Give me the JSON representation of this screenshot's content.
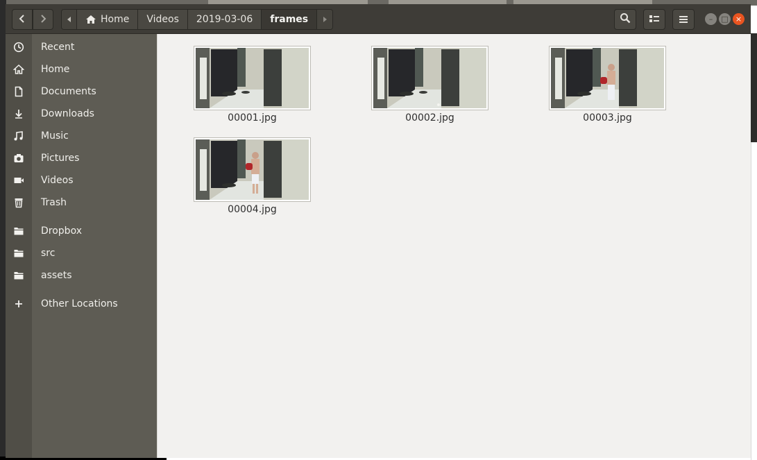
{
  "window": {
    "nav": {
      "back_icon": "chevron-left-icon",
      "forward_icon": "chevron-right-icon"
    },
    "pathbar": {
      "items": [
        "Home",
        "Videos",
        "2019-03-06",
        "frames"
      ],
      "home_icon": "home-icon"
    },
    "toolbar": {
      "search_icon": "search-icon",
      "view_icon": "list-view-icon",
      "menu_icon": "hamburger-menu-icon"
    },
    "controls": {
      "minimize": "–",
      "maximize": "□",
      "close": "×"
    }
  },
  "sidebar": {
    "items": [
      {
        "label": "Recent",
        "icon": "recent-clock-icon"
      },
      {
        "label": "Home",
        "icon": "home-icon"
      },
      {
        "label": "Documents",
        "icon": "document-icon"
      },
      {
        "label": "Downloads",
        "icon": "download-icon"
      },
      {
        "label": "Music",
        "icon": "music-icon"
      },
      {
        "label": "Pictures",
        "icon": "camera-icon"
      },
      {
        "label": "Videos",
        "icon": "video-icon"
      },
      {
        "label": "Trash",
        "icon": "trash-icon"
      },
      {
        "label": "Dropbox",
        "icon": "folder-icon"
      },
      {
        "label": "src",
        "icon": "folder-icon"
      },
      {
        "label": "assets",
        "icon": "folder-icon"
      },
      {
        "label": "Other Locations",
        "icon": "plus-icon"
      }
    ]
  },
  "files": [
    {
      "name": "00001.jpg"
    },
    {
      "name": "00002.jpg"
    },
    {
      "name": "00003.jpg"
    },
    {
      "name": "00004.jpg"
    }
  ],
  "colors": {
    "headerbar": "#3e3c37",
    "sidebar": "#5e5c54",
    "content": "#f2f1ef",
    "close_button": "#e95420"
  }
}
